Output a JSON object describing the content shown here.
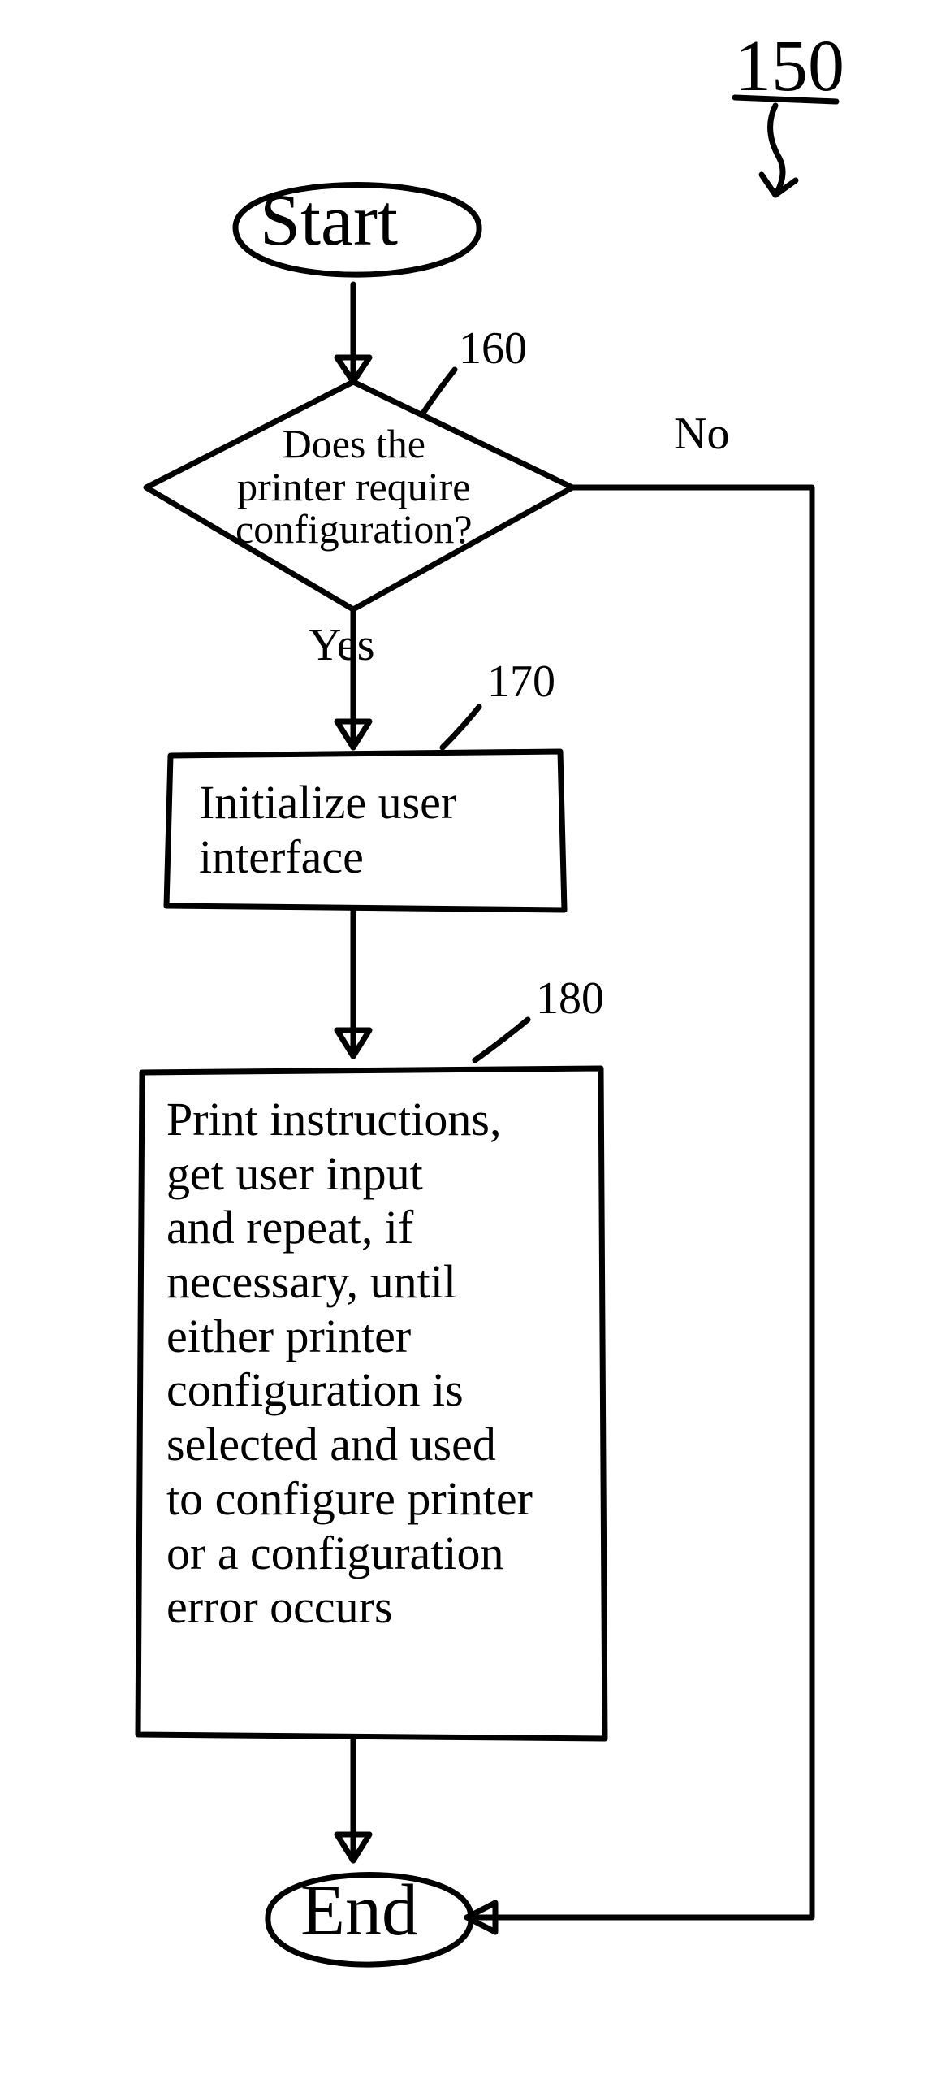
{
  "flow": {
    "figure_ref": "150",
    "start": "Start",
    "end": "End",
    "decision": {
      "ref": "160",
      "text": "Does the\nprinter require\nconfiguration?",
      "yes": "Yes",
      "no": "No"
    },
    "step_init": {
      "ref": "170",
      "text": "Initialize user\ninterface"
    },
    "step_print": {
      "ref": "180",
      "text": "Print instructions,\nget user input\nand repeat, if\nnecessary, until\neither printer\nconfiguration is\nselected and used\nto configure printer\nor a configuration\nerror occurs"
    }
  }
}
